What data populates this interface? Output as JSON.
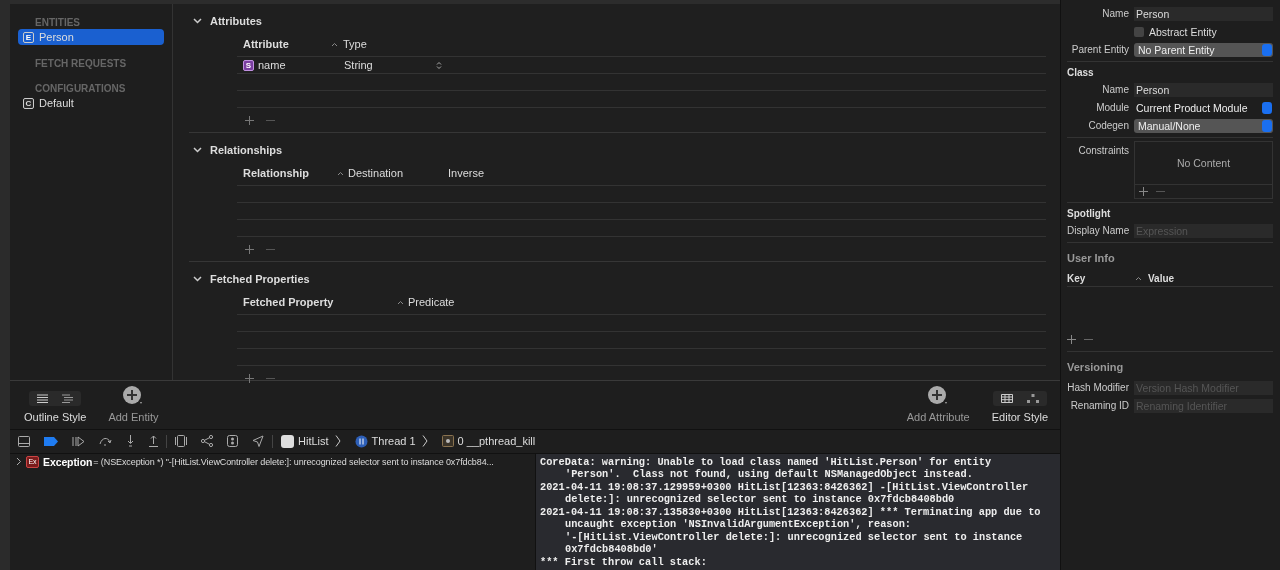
{
  "sidebar": {
    "groups": [
      {
        "heading": "ENTITIES",
        "items": [
          {
            "badge": "E",
            "label": "Person",
            "selected": true
          }
        ]
      },
      {
        "heading": "FETCH REQUESTS"
      },
      {
        "heading": "CONFIGURATIONS",
        "items": [
          {
            "badge": "C",
            "label": "Default",
            "selected": false
          }
        ]
      }
    ]
  },
  "sections": [
    {
      "title": "Attributes",
      "expanded": true,
      "columns": [
        "Attribute",
        "Type"
      ],
      "rows": [
        {
          "badge": "S",
          "cells": [
            "name",
            "String"
          ]
        }
      ]
    },
    {
      "title": "Relationships",
      "expanded": true,
      "columns": [
        "Relationship",
        "Destination",
        "Inverse"
      ]
    },
    {
      "title": "Fetched Properties",
      "expanded": true,
      "columns": [
        "Fetched Property",
        "Predicate"
      ]
    }
  ],
  "bottom_bar": {
    "outline_style": "Outline Style",
    "add_entity": "Add Entity",
    "add_attribute": "Add Attribute",
    "editor_style": "Editor Style"
  },
  "debug_bar": {
    "breadcrumbs": [
      "HitList",
      "Thread 1",
      "0 __pthread_kill"
    ]
  },
  "variables": [
    {
      "badge": "Ex",
      "name": "Exception",
      "value": "= (NSException *) \"-[HitList.ViewController delete:]: unrecognized selector sent to instance 0x7fdcb84..."
    }
  ],
  "console": [
    {
      "kind": "start",
      "text": "CoreData: warning: Unable to load class named 'HitList.Person' for entity"
    },
    {
      "kind": "continuation",
      "text": "'Person'.  Class not found, using default NSManagedObject instead."
    },
    {
      "kind": "start",
      "text": "2021-04-11 19:08:37.129959+0300 HitList[12363:8426362] -[HitList.ViewController"
    },
    {
      "kind": "continuation",
      "text": "delete:]: unrecognized selector sent to instance 0x7fdcb8408bd0"
    },
    {
      "kind": "start",
      "text": "2021-04-11 19:08:37.135830+0300 HitList[12363:8426362] *** Terminating app due to"
    },
    {
      "kind": "continuation",
      "text": "uncaught exception 'NSInvalidArgumentException', reason:"
    },
    {
      "kind": "continuation",
      "text": "'-[HitList.ViewController delete:]: unrecognized selector sent to instance"
    },
    {
      "kind": "continuation",
      "text": "0x7fdcb8408bd0'"
    },
    {
      "kind": "start",
      "text": "*** First throw call stack:"
    }
  ],
  "inspector": {
    "entity": {
      "name_label": "Name",
      "name": "Person",
      "abstract_label": "Abstract Entity",
      "abstract_checked": false,
      "parent_label": "Parent Entity",
      "parent": "No Parent Entity"
    },
    "class": {
      "title": "Class",
      "name_label": "Name",
      "name": "Person",
      "module_label": "Module",
      "module": "Current Product Module",
      "codegen_label": "Codegen",
      "codegen": "Manual/None"
    },
    "constraints": {
      "label": "Constraints",
      "empty": "No Content"
    },
    "spotlight": {
      "title": "Spotlight",
      "display_label": "Display Name",
      "display_placeholder": "Expression"
    },
    "user_info": {
      "title": "User Info",
      "columns": [
        "Key",
        "Value"
      ]
    },
    "versioning": {
      "title": "Versioning",
      "hash_label": "Hash Modifier",
      "hash_placeholder": "Version Hash Modifier",
      "renaming_label": "Renaming ID",
      "renaming_placeholder": "Renaming Identifier"
    }
  }
}
